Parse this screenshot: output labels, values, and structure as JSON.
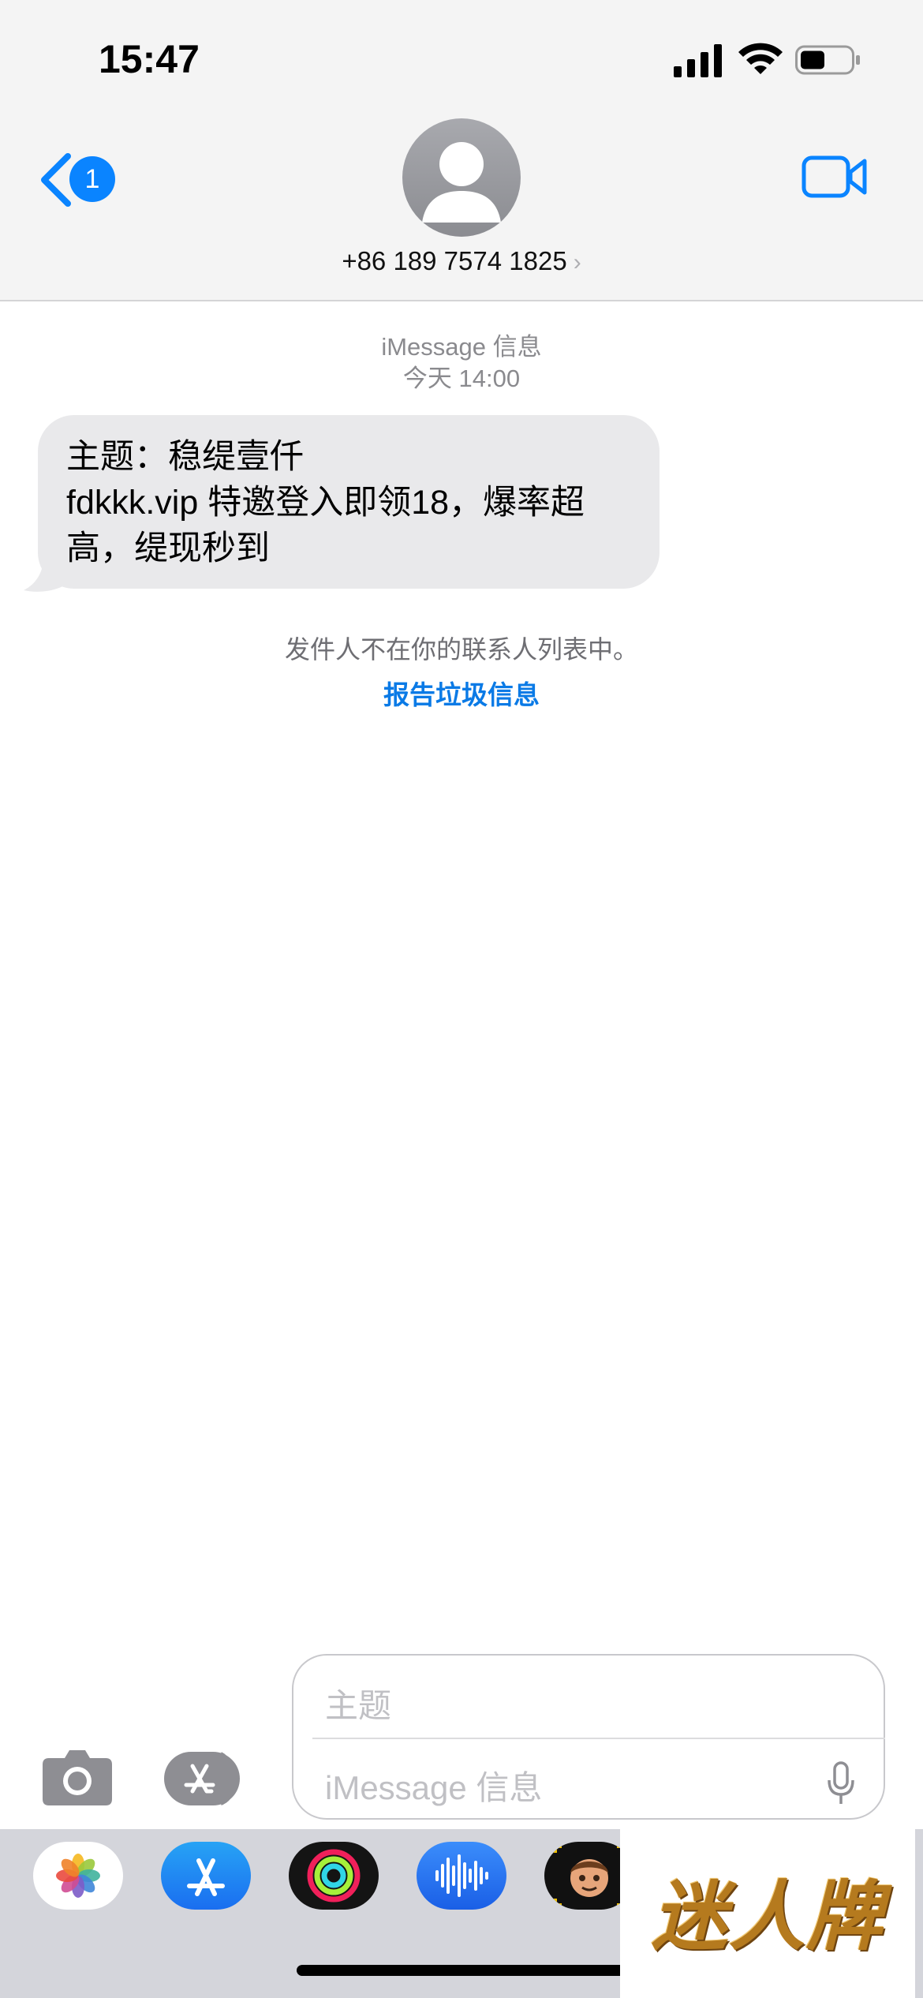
{
  "status_bar": {
    "time": "15:47"
  },
  "header": {
    "back_badge_count": "1",
    "contact_name": "+86 189 7574 1825",
    "contact_chevron": "›"
  },
  "conversation": {
    "service_label": "iMessage 信息",
    "timestamp": "今天 14:00",
    "messages": [
      {
        "direction": "incoming",
        "text": "主题：稳缇壹仟\nfdkkk.vip  特邀登入即领18，爆率超高，缇现秒到"
      }
    ],
    "unknown_sender_notice": "发件人不在你的联系人列表中。",
    "report_link": "报告垃圾信息"
  },
  "composer": {
    "subject_placeholder": "主题",
    "message_placeholder": "iMessage 信息"
  },
  "app_drawer": {
    "apps": [
      "photos-icon",
      "app-store-icon",
      "fitness-icon",
      "audio-message-icon",
      "memoji-icon"
    ]
  },
  "watermark": {
    "text": "迷人牌"
  },
  "colors": {
    "accent": "#0a84ff",
    "link": "#0a7ae6",
    "bubble_incoming": "#e9e9eb",
    "header_bg": "#f4f4f4"
  }
}
